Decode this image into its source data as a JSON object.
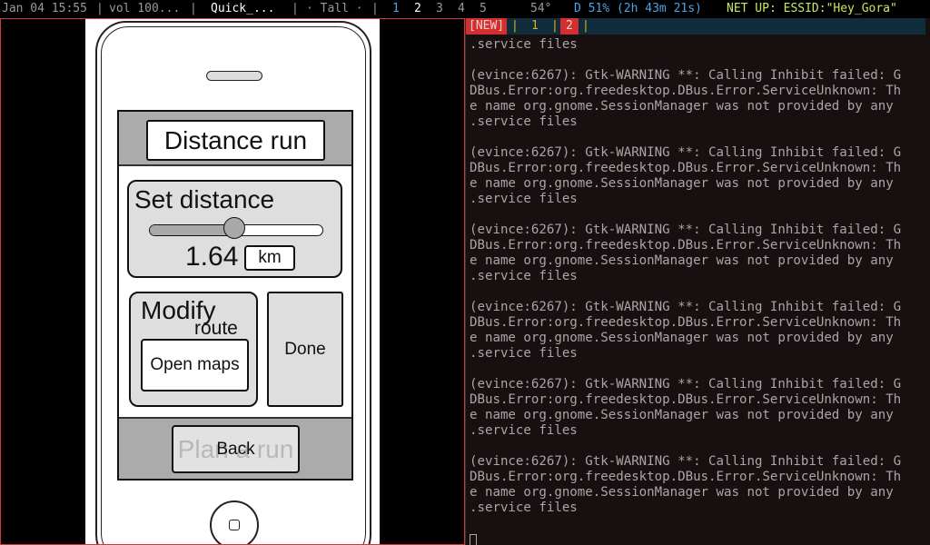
{
  "statusbar": {
    "datetime": "Jan 04 15:55",
    "sep1": "|",
    "volume": "vol 100...",
    "sep2": "|",
    "window_title": "Quick_...",
    "sep3": "|",
    "layout": "· Tall ·",
    "sep4": "|",
    "workspaces": [
      "1",
      "2",
      "3",
      "4",
      "5"
    ],
    "temperature": "54°",
    "battery": "D 51% (2h 43m 21s)",
    "network": "NET UP: ESSID:\"Hey_Gora\""
  },
  "mockup": {
    "title": "Distance run",
    "set_distance_label": "Set distance",
    "slider_position": 0.49,
    "distance_value": "1.64",
    "unit": "km",
    "modify_label": "Modify",
    "route_label": "route",
    "open_maps_label": "Open maps",
    "done_label": "Done",
    "footer_ghost_text": "Plan a run",
    "back_label": "Back"
  },
  "terminal": {
    "tabs": {
      "new_label": "[NEW]",
      "sep_a": "|",
      "tab1": "1",
      "sep_b": "|",
      "tab2": "2",
      "sep_c": "|"
    },
    "lines": [
      ".service files",
      "",
      "(evince:6267): Gtk-WARNING **: Calling Inhibit failed: G",
      "DBus.Error:org.freedesktop.DBus.Error.ServiceUnknown: Th",
      "e name org.gnome.SessionManager was not provided by any",
      ".service files",
      "",
      "(evince:6267): Gtk-WARNING **: Calling Inhibit failed: G",
      "DBus.Error:org.freedesktop.DBus.Error.ServiceUnknown: Th",
      "e name org.gnome.SessionManager was not provided by any",
      ".service files",
      "",
      "(evince:6267): Gtk-WARNING **: Calling Inhibit failed: G",
      "DBus.Error:org.freedesktop.DBus.Error.ServiceUnknown: Th",
      "e name org.gnome.SessionManager was not provided by any",
      ".service files",
      "",
      "(evince:6267): Gtk-WARNING **: Calling Inhibit failed: G",
      "DBus.Error:org.freedesktop.DBus.Error.ServiceUnknown: Th",
      "e name org.gnome.SessionManager was not provided by any",
      ".service files",
      "",
      "(evince:6267): Gtk-WARNING **: Calling Inhibit failed: G",
      "DBus.Error:org.freedesktop.DBus.Error.ServiceUnknown: Th",
      "e name org.gnome.SessionManager was not provided by any",
      ".service files",
      "",
      "(evince:6267): Gtk-WARNING **: Calling Inhibit failed: G",
      "DBus.Error:org.freedesktop.DBus.Error.ServiceUnknown: Th",
      "e name org.gnome.SessionManager was not provided by any",
      ".service files"
    ]
  },
  "colors": {
    "focus_border": "#d23a3a",
    "terminal_bg": "#181010",
    "terminal_text": "#a7a7a7",
    "tabbar_bg": "#0f2d3a",
    "accent_red": "#d32f2f",
    "accent_yellow": "#e0b020",
    "workspace_blue": "#4aa3e8",
    "net_green": "#c8e860"
  }
}
